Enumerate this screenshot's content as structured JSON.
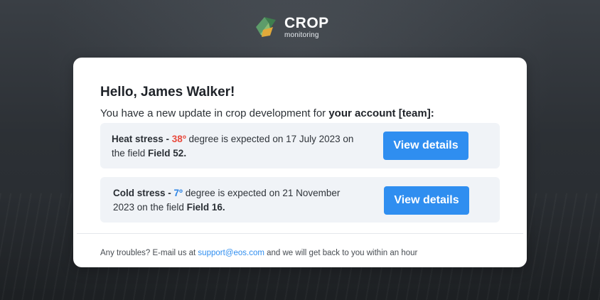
{
  "brand": {
    "title": "CROP",
    "subtitle": "monitoring",
    "icon": "crop-leaf-logo-icon"
  },
  "email": {
    "greeting": "Hello, James Walker!",
    "intro_prefix": "You have a new update in crop development for ",
    "intro_bold": "your account [team]:",
    "alerts": [
      {
        "label": "Heat stress - ",
        "temperature": "38º",
        "middle": " degree is expected on 17 July 2023 on the field ",
        "field": "Field 52.",
        "button": "View details",
        "temp_color": "#e84a3d"
      },
      {
        "label": "Cold stress - ",
        "temperature": "7º",
        "middle": " degree is expected on 21 November 2023 on the field ",
        "field": "Field 16.",
        "button": "View details",
        "temp_color": "#2f86e6"
      }
    ],
    "footer_prefix": "Any troubles? E-mail us at ",
    "footer_email": "support@eos.com",
    "footer_suffix": " and we will get back to you within an hour"
  },
  "colors": {
    "accent": "#2f8ef0",
    "background": "#2f3338",
    "card": "#ffffff",
    "alert_bg": "#f0f3f7"
  }
}
